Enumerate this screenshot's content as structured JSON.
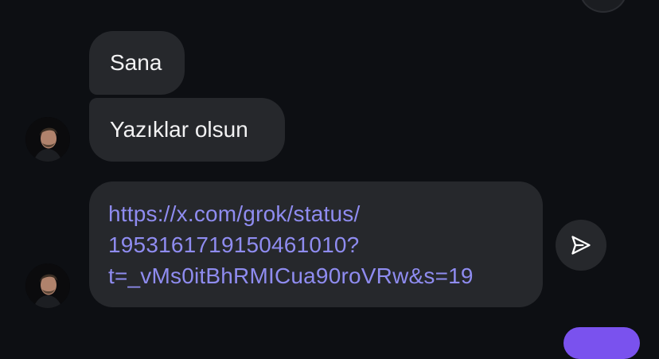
{
  "messages": [
    {
      "text": "Sana"
    },
    {
      "text": "Yazıklar olsun"
    }
  ],
  "link_message": {
    "lines": [
      "https://x.com/grok/status/",
      "1953161719150461010?",
      "t=_vMs0itBhRMICua90roVRw&s=19"
    ]
  },
  "icons": {
    "share": "paper-plane-icon",
    "avatar": "user-avatar-photo"
  },
  "colors": {
    "background": "#0d0f13",
    "bubble": "#26282c",
    "text": "#f2f2f3",
    "link": "#8f8cf0",
    "accent": "#7a52ee"
  }
}
